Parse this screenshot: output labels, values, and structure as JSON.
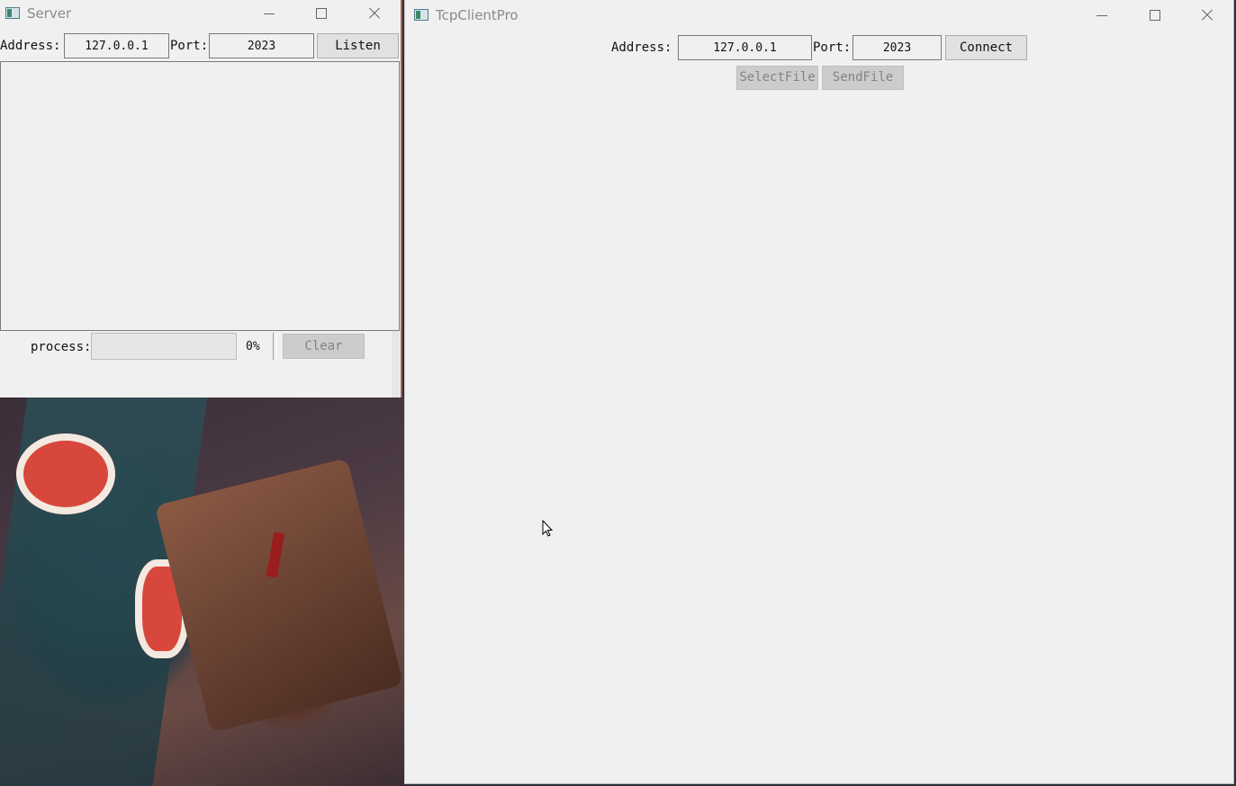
{
  "server_window": {
    "title": "Server",
    "address_label": "Address:",
    "address_value": "127.0.0.1",
    "port_label": "Port:",
    "port_value": "2023",
    "listen_label": "Listen",
    "process_label": "process:",
    "progress_percent_text": "0%",
    "progress_fraction": 0,
    "clear_label": "Clear"
  },
  "client_window": {
    "title": "TcpClientPro",
    "address_label": "Address:",
    "address_value": "127.0.0.1",
    "port_label": "Port:",
    "port_value": "2023",
    "connect_label": "Connect",
    "select_file_label": "SelectFile",
    "send_file_label": "SendFile"
  },
  "colors": {
    "window_bg": "#f0f0f0",
    "progress_fill": "#06b025",
    "disabled_text": "#838383"
  },
  "icons": [
    "app-icon",
    "minimize-icon",
    "maximize-icon",
    "close-icon",
    "mouse-cursor-icon"
  ]
}
